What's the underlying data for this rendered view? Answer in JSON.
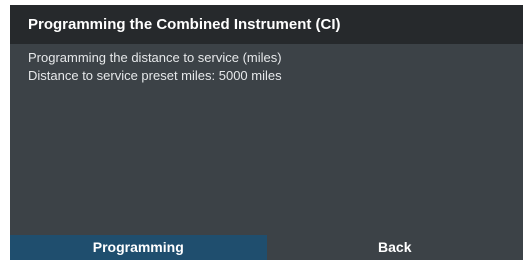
{
  "window": {
    "title": "Programming the Combined Instrument (CI)"
  },
  "content": {
    "lines": [
      "Programming the distance to service (miles)",
      "Distance to service preset miles: 5000 miles"
    ]
  },
  "buttons": {
    "primary_label": "Programming",
    "secondary_label": "Back"
  },
  "colors": {
    "titlebar": "#26292c",
    "body": "#3c4247",
    "primary_button": "#1f4e6e"
  }
}
